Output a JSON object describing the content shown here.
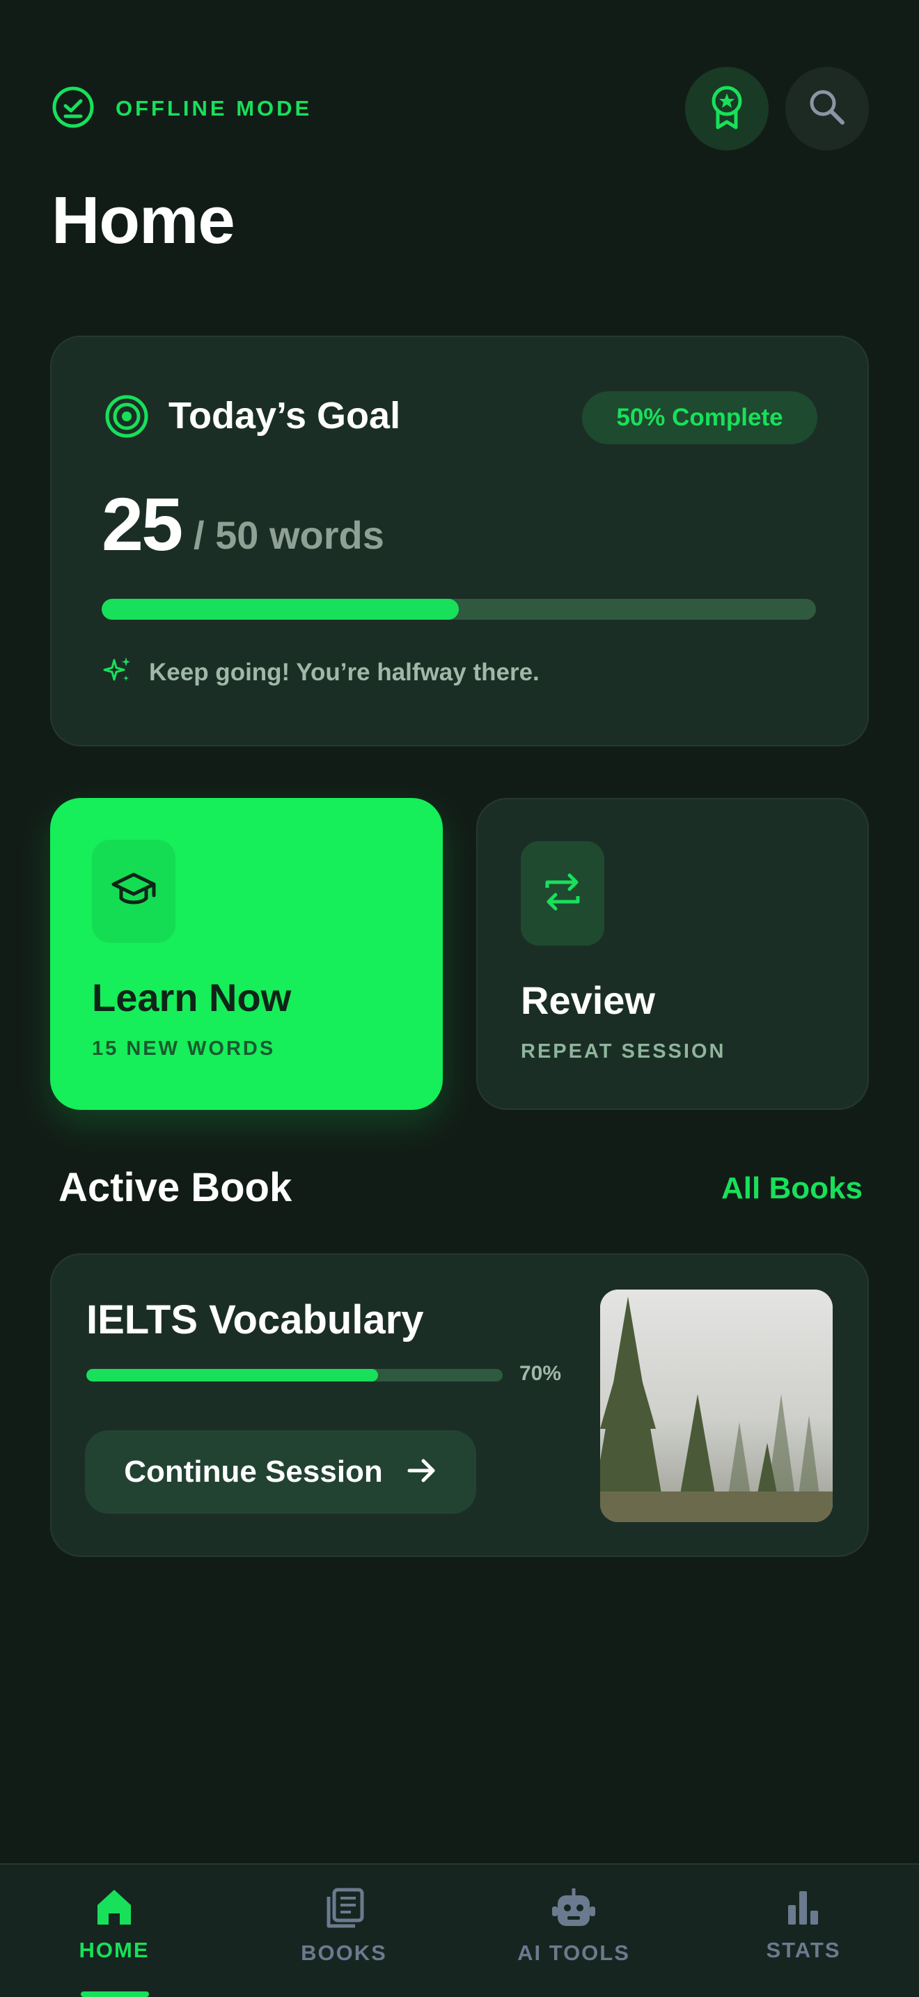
{
  "header": {
    "status_label": "OFFLINE MODE",
    "title": "Home",
    "icons": [
      "check-circle-icon",
      "award-badge-icon",
      "search-icon"
    ]
  },
  "goal": {
    "title": "Today’s Goal",
    "complete_label": "50% Complete",
    "current": "25",
    "total_label": "/ 50 words",
    "progress": 0.5,
    "message": "Keep going! You’re halfway there."
  },
  "actions": {
    "learn": {
      "title": "Learn Now",
      "subtitle": "15 NEW WORDS"
    },
    "review": {
      "title": "Review",
      "subtitle": "REPEAT SESSION"
    }
  },
  "active_book": {
    "section_title": "Active Book",
    "all_books_label": "All Books",
    "title": "IELTS Vocabulary",
    "progress": 0.7,
    "progress_label": "70%",
    "continue_label": "Continue Session"
  },
  "nav": {
    "items": [
      {
        "label": "HOME",
        "icon": "home-icon",
        "active": true
      },
      {
        "label": "BOOKS",
        "icon": "books-icon",
        "active": false
      },
      {
        "label": "AI TOOLS",
        "icon": "robot-icon",
        "active": false
      },
      {
        "label": "STATS",
        "icon": "bar-chart-icon",
        "active": false
      }
    ]
  },
  "colors": {
    "background": "#121c17",
    "accent": "#18e05a",
    "card": "#1b2e25",
    "muted": "#6b7a8e"
  }
}
